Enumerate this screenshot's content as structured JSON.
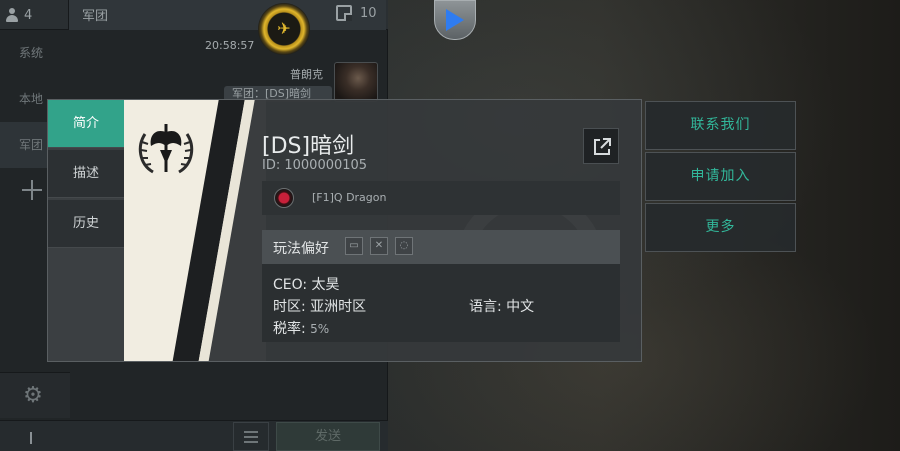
{
  "chat": {
    "player_count": "4",
    "tab_label": "军团",
    "unread_count": "10",
    "channels": [
      {
        "label": "系统"
      },
      {
        "label": "本地"
      },
      {
        "label": "军团"
      }
    ],
    "message": {
      "time": "20:58:57",
      "sender": "普朗克",
      "text": "军团：[DS]暗剑"
    },
    "send_label": "发送"
  },
  "dialog": {
    "tabs": [
      {
        "label": "简介"
      },
      {
        "label": "描述"
      },
      {
        "label": "历史"
      }
    ],
    "corp_name": "[DS]暗剑",
    "corp_id": "ID: 1000000105",
    "alliance_name": "[F1]Q Dragon",
    "preferences_label": "玩法偏好",
    "info": {
      "ceo": "CEO: 太昊",
      "timezone": "时区: 亚洲时区",
      "language": "语言: 中文",
      "tax_label": "税率:",
      "tax_value": "5%"
    }
  },
  "actions": [
    {
      "label": "联系我们"
    },
    {
      "label": "申请加入"
    },
    {
      "label": "更多"
    }
  ],
  "icons": {
    "share": "external-link-icon",
    "settings": "gear-icon",
    "play": "play-icon",
    "corp_badge": "corp-badge-icon"
  },
  "colors": {
    "accent": "#32a38a",
    "action_text": "#32b79a"
  }
}
